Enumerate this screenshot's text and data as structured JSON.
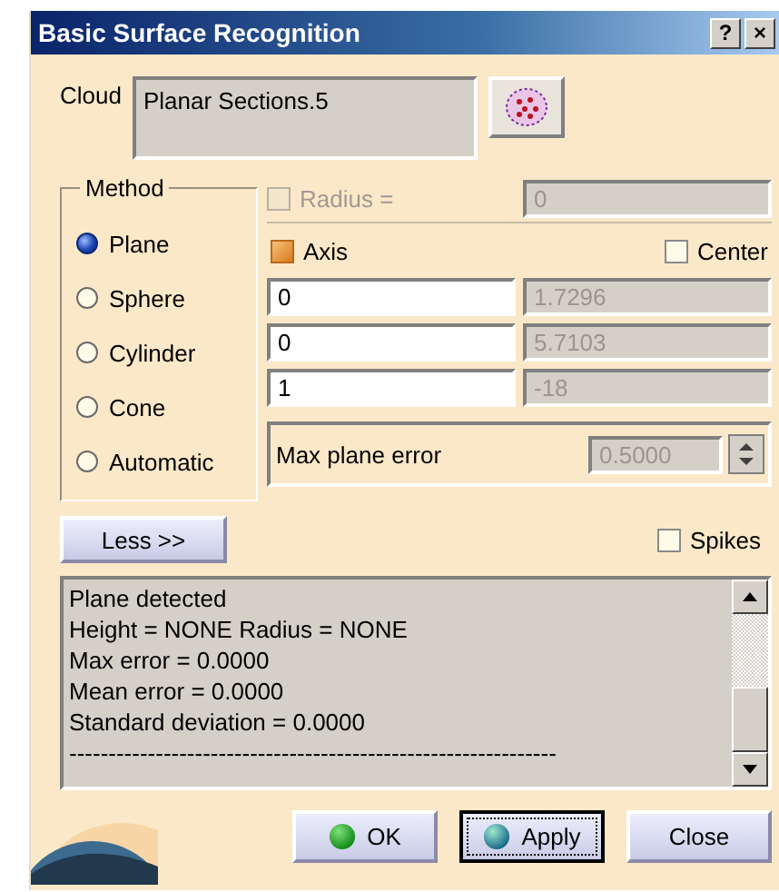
{
  "window": {
    "title": "Basic Surface Recognition",
    "help": "?",
    "close": "×"
  },
  "cloud": {
    "label": "Cloud",
    "value": "Planar Sections.5"
  },
  "method": {
    "title": "Method",
    "options": [
      {
        "label": "Plane",
        "selected": true
      },
      {
        "label": "Sphere",
        "selected": false
      },
      {
        "label": "Cylinder",
        "selected": false
      },
      {
        "label": "Cone",
        "selected": false
      },
      {
        "label": "Automatic",
        "selected": false
      }
    ]
  },
  "radius": {
    "label": "Radius =",
    "checked": false,
    "disabled": true,
    "value": "0"
  },
  "axis": {
    "label": "Axis",
    "checked": true
  },
  "center": {
    "label": "Center",
    "checked": false
  },
  "vector_rows": [
    {
      "input": "0",
      "output": "1.7296"
    },
    {
      "input": "0",
      "output": "5.7103"
    },
    {
      "input": "1",
      "output": "-18"
    }
  ],
  "max_plane_error": {
    "label": "Max plane error",
    "value": "0.5000"
  },
  "less_button": "Less >>",
  "spikes": {
    "label": "Spikes",
    "checked": false
  },
  "log": {
    "lines": [
      "Plane detected",
      "Height = NONE Radius = NONE",
      "Max error = 0.0000",
      "Mean error = 0.0000",
      "Standard deviation = 0.0000",
      "--------------------------------------------------------------"
    ]
  },
  "buttons": [
    {
      "label": "OK",
      "kind": "ok",
      "focused": false
    },
    {
      "label": "Apply",
      "kind": "apply",
      "focused": true
    },
    {
      "label": "Close",
      "kind": "close",
      "focused": false
    }
  ]
}
